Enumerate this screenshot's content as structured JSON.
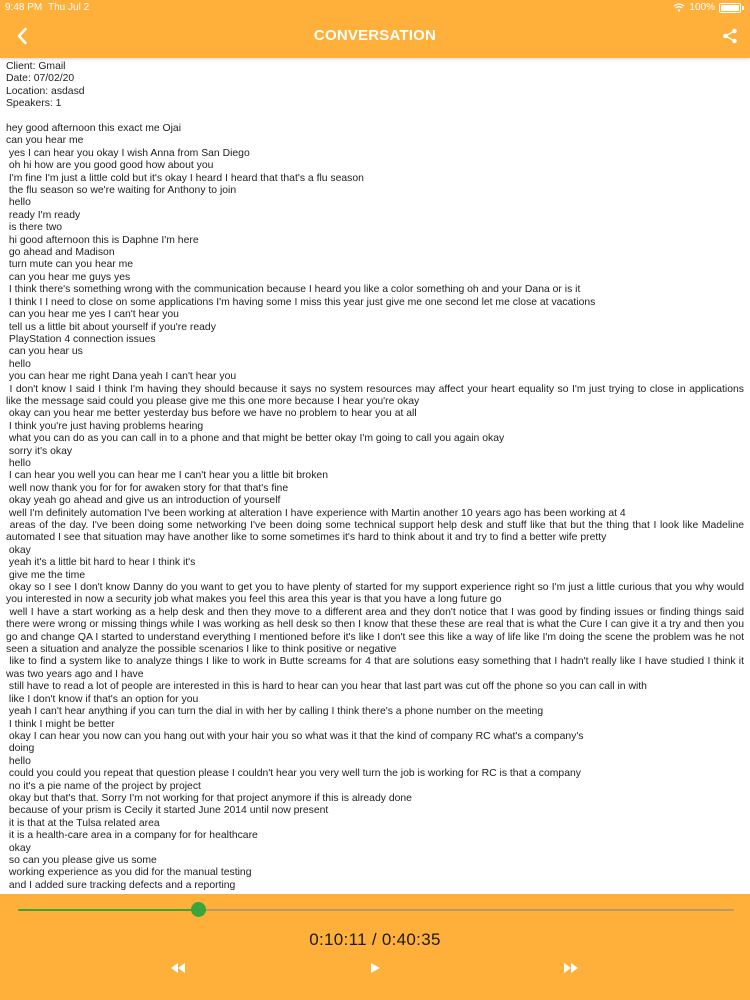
{
  "status_bar": {
    "time": "9:48 PM",
    "date": "Thu Jul 2",
    "battery": "100%"
  },
  "header": {
    "title": "CONVERSATION",
    "back_icon": "chevron-left-icon",
    "share_icon": "share-icon"
  },
  "meta": [
    "Client: Gmail",
    "Date: 07/02/20",
    "Location: asdasd",
    "Speakers: 1"
  ],
  "transcript": [
    "hey good afternoon this exact me Ojai",
    "can you hear me",
    " yes I can hear you okay I wish Anna from San Diego",
    " oh hi how are you good good how about you",
    " I'm fine I'm just a little cold but it's okay I heard I heard that that's a flu season",
    " the flu season so we're waiting for Anthony to join",
    " hello",
    " ready I'm ready",
    " is there two",
    " hi good afternoon this is Daphne I'm here",
    " go ahead and Madison",
    " turn mute can you hear me",
    " can you hear me guys yes",
    " I think there's something wrong with the communication because I heard you like a color something oh and your Dana or is it",
    " I think I I need to close on some applications I'm having some I miss this year just give me one second let me close at vacations",
    " can you hear me yes I can't hear you",
    " tell us a little bit about yourself if you're ready",
    " PlayStation 4 connection issues",
    " can you hear us",
    " hello",
    " you can hear me right Dana yeah I can't hear you",
    " I don't know I said I think I'm having they should because it says no system resources may affect your heart equality so I'm just trying to close in applications like the message said could you please give me this one more because I hear you're okay",
    " okay can you hear me better yesterday bus before we have no problem to hear you at all",
    " I think you're just having problems hearing",
    " what you can do as you can call in to a phone and that might be better okay I'm going to call you again okay",
    " sorry it's okay",
    " hello",
    " I can hear you well you can hear me I can't hear you a little bit broken",
    " well now thank you for for for awaken story for that that's fine",
    " okay yeah go ahead and give us an introduction of yourself",
    " well I'm definitely automation I've been working at alteration I have experience with Martin another 10 years ago has been working at 4",
    " areas of the day. I've been doing some networking I've been doing some technical support help desk and stuff like that but the thing that I look like Madeline automated I see that situation may have another like to some sometimes it's hard to think about it and try to find a better wife pretty",
    " okay",
    " yeah it's a little bit hard to hear I think it's",
    " give me the time",
    " okay so I see I don't know Danny do you want to get you to have plenty of started for my support experience right so I'm just a little curious that you why would you interested in now a security job what makes you feel this area this year is that you have a long future go",
    " well I have a start working as a help desk and then they move to a different area and they don't notice that I was good by finding issues or finding things said there were wrong or missing things while I was working as hell desk so then I know that these these are real that is what the Cure I can give it a try and then you go and change QA I started to understand everything I mentioned before it's like I don't see this like a way of life like I'm doing the scene the problem was he not seen a situation and analyze the possible scenarios I like to think positive or negative",
    " like to find a system like to analyze things I like to work in Butte screams for 4 that are solutions easy something that I hadn't really like I have studied I think it was two years ago and I have",
    " still have to read a lot of people are interested in this is hard to hear can you hear that last part was cut off the phone so you can call in with",
    " like I don't know if that's an option for you",
    " yeah I can't hear anything if you can turn the dial in with her by calling I think there's a phone number on the meeting",
    " I think I might be better",
    " okay I can hear you now can you hang out with your hair you so what was it that the kind of company RC what's a company's",
    " doing",
    " hello",
    " could you could you repeat that question please I couldn't hear you very well turn the job is working for RC is that a company",
    " no it's a pie name of the project by project",
    " okay but that's that. Sorry I'm not working for that project anymore if this is already done",
    " because of your prism is Cecily it started June 2014 until now present",
    " it is that at the Tulsa related area",
    " it is a health-care area in a company for for healthcare",
    " okay",
    " so can you please give us some",
    " working experience as you did for the manual testing",
    " and I added sure tracking defects and a reporting"
  ],
  "player": {
    "timecode": "0:10:11 / 0:40:35",
    "progress": 0.251,
    "controls": {
      "rewind": "rewind-icon",
      "play": "play-icon",
      "fast_forward": "fast-forward-icon"
    },
    "colors": {
      "bar": "#FEB03B",
      "progress": "#3AA53A"
    }
  }
}
